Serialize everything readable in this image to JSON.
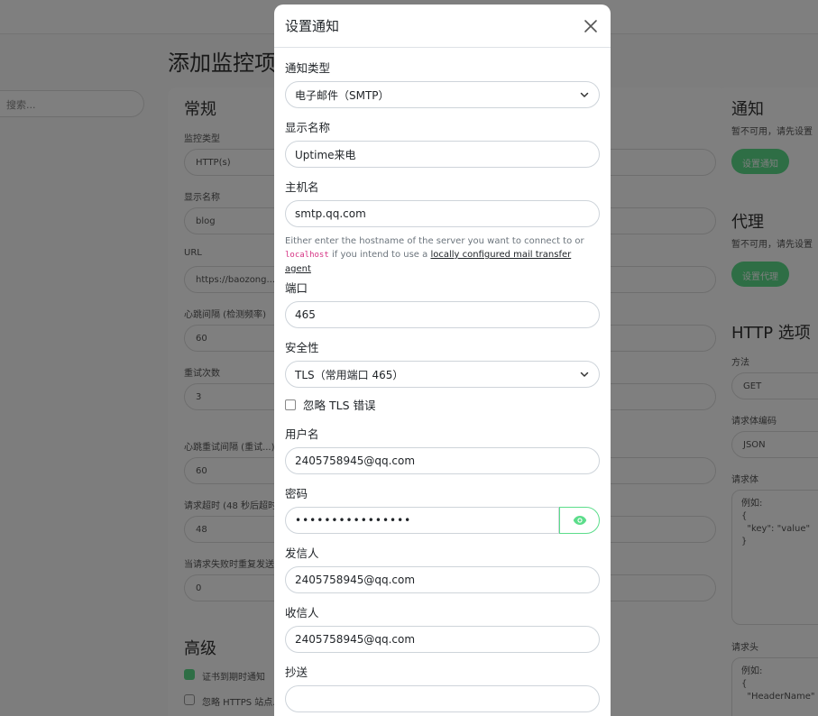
{
  "background": {
    "page_title": "添加监控项",
    "search_placeholder": "搜索...",
    "general_heading": "常规",
    "fields": [
      {
        "label": "监控类型",
        "value": "HTTP(s)"
      },
      {
        "label": "显示名称",
        "value": "blog"
      },
      {
        "label": "URL",
        "value": "https://baozong..."
      },
      {
        "label": "心跳间隔 (检测频率)",
        "value": "60"
      },
      {
        "label": "重试次数",
        "value": "3"
      },
      {
        "label": "心跳重试间隔 (重试...)",
        "value": "60"
      },
      {
        "label": "请求超时 (48 秒后超时)",
        "value": "48"
      },
      {
        "label": "当请求失败时重复发送...",
        "value": "0"
      }
    ],
    "advanced_heading": "高级",
    "advanced_items": [
      "证书到期时通知",
      "忽略 HTTPS 站点..."
    ],
    "notify_heading": "通知",
    "notify_text": "暂不可用，请先设置",
    "notify_button": "设置通知",
    "proxy_heading": "代理",
    "proxy_text": "暂不可用，请先设置",
    "proxy_button": "设置代理",
    "http_heading": "HTTP 选项",
    "method_label": "方法",
    "method_value": "GET",
    "body_encoding_label": "请求体编码",
    "body_encoding_value": "JSON",
    "body_label": "请求体",
    "body_placeholder": "例如:\n{\n  \"key\": \"value\"\n}",
    "headers_label": "请求头",
    "headers_placeholder": "例如:\n{\n  \"HeaderName\""
  },
  "modal": {
    "title": "设置通知",
    "notification_type": {
      "label": "通知类型",
      "value": "电子邮件（SMTP）"
    },
    "display_name": {
      "label": "显示名称",
      "value": "Uptime来电"
    },
    "hostname": {
      "label": "主机名",
      "value": "smtp.qq.com",
      "help_prefix": "Either enter the hostname of the server you want to connect to or ",
      "help_code": "localhost",
      "help_middle": " if you intend to use a ",
      "help_link": "locally configured mail transfer agent"
    },
    "port": {
      "label": "端口",
      "value": "465"
    },
    "security": {
      "label": "安全性",
      "value": "TLS（常用端口 465）"
    },
    "ignore_tls": {
      "label": "忽略 TLS 错误",
      "checked": false
    },
    "username": {
      "label": "用户名",
      "value": "2405758945@qq.com"
    },
    "password": {
      "label": "密码",
      "value": "••••••••••••••••"
    },
    "from": {
      "label": "发信人",
      "value": "2405758945@qq.com"
    },
    "to": {
      "label": "收信人",
      "value": "2405758945@qq.com"
    },
    "cc": {
      "label": "抄送",
      "value": ""
    },
    "bcc": {
      "label": "密送"
    }
  },
  "colors": {
    "accent": "#5cdd8b",
    "border": "#ced4da",
    "code": "#d63384"
  },
  "icons": {
    "close": "close-icon",
    "chevron": "chevron-down-icon",
    "eye": "eye-icon"
  }
}
